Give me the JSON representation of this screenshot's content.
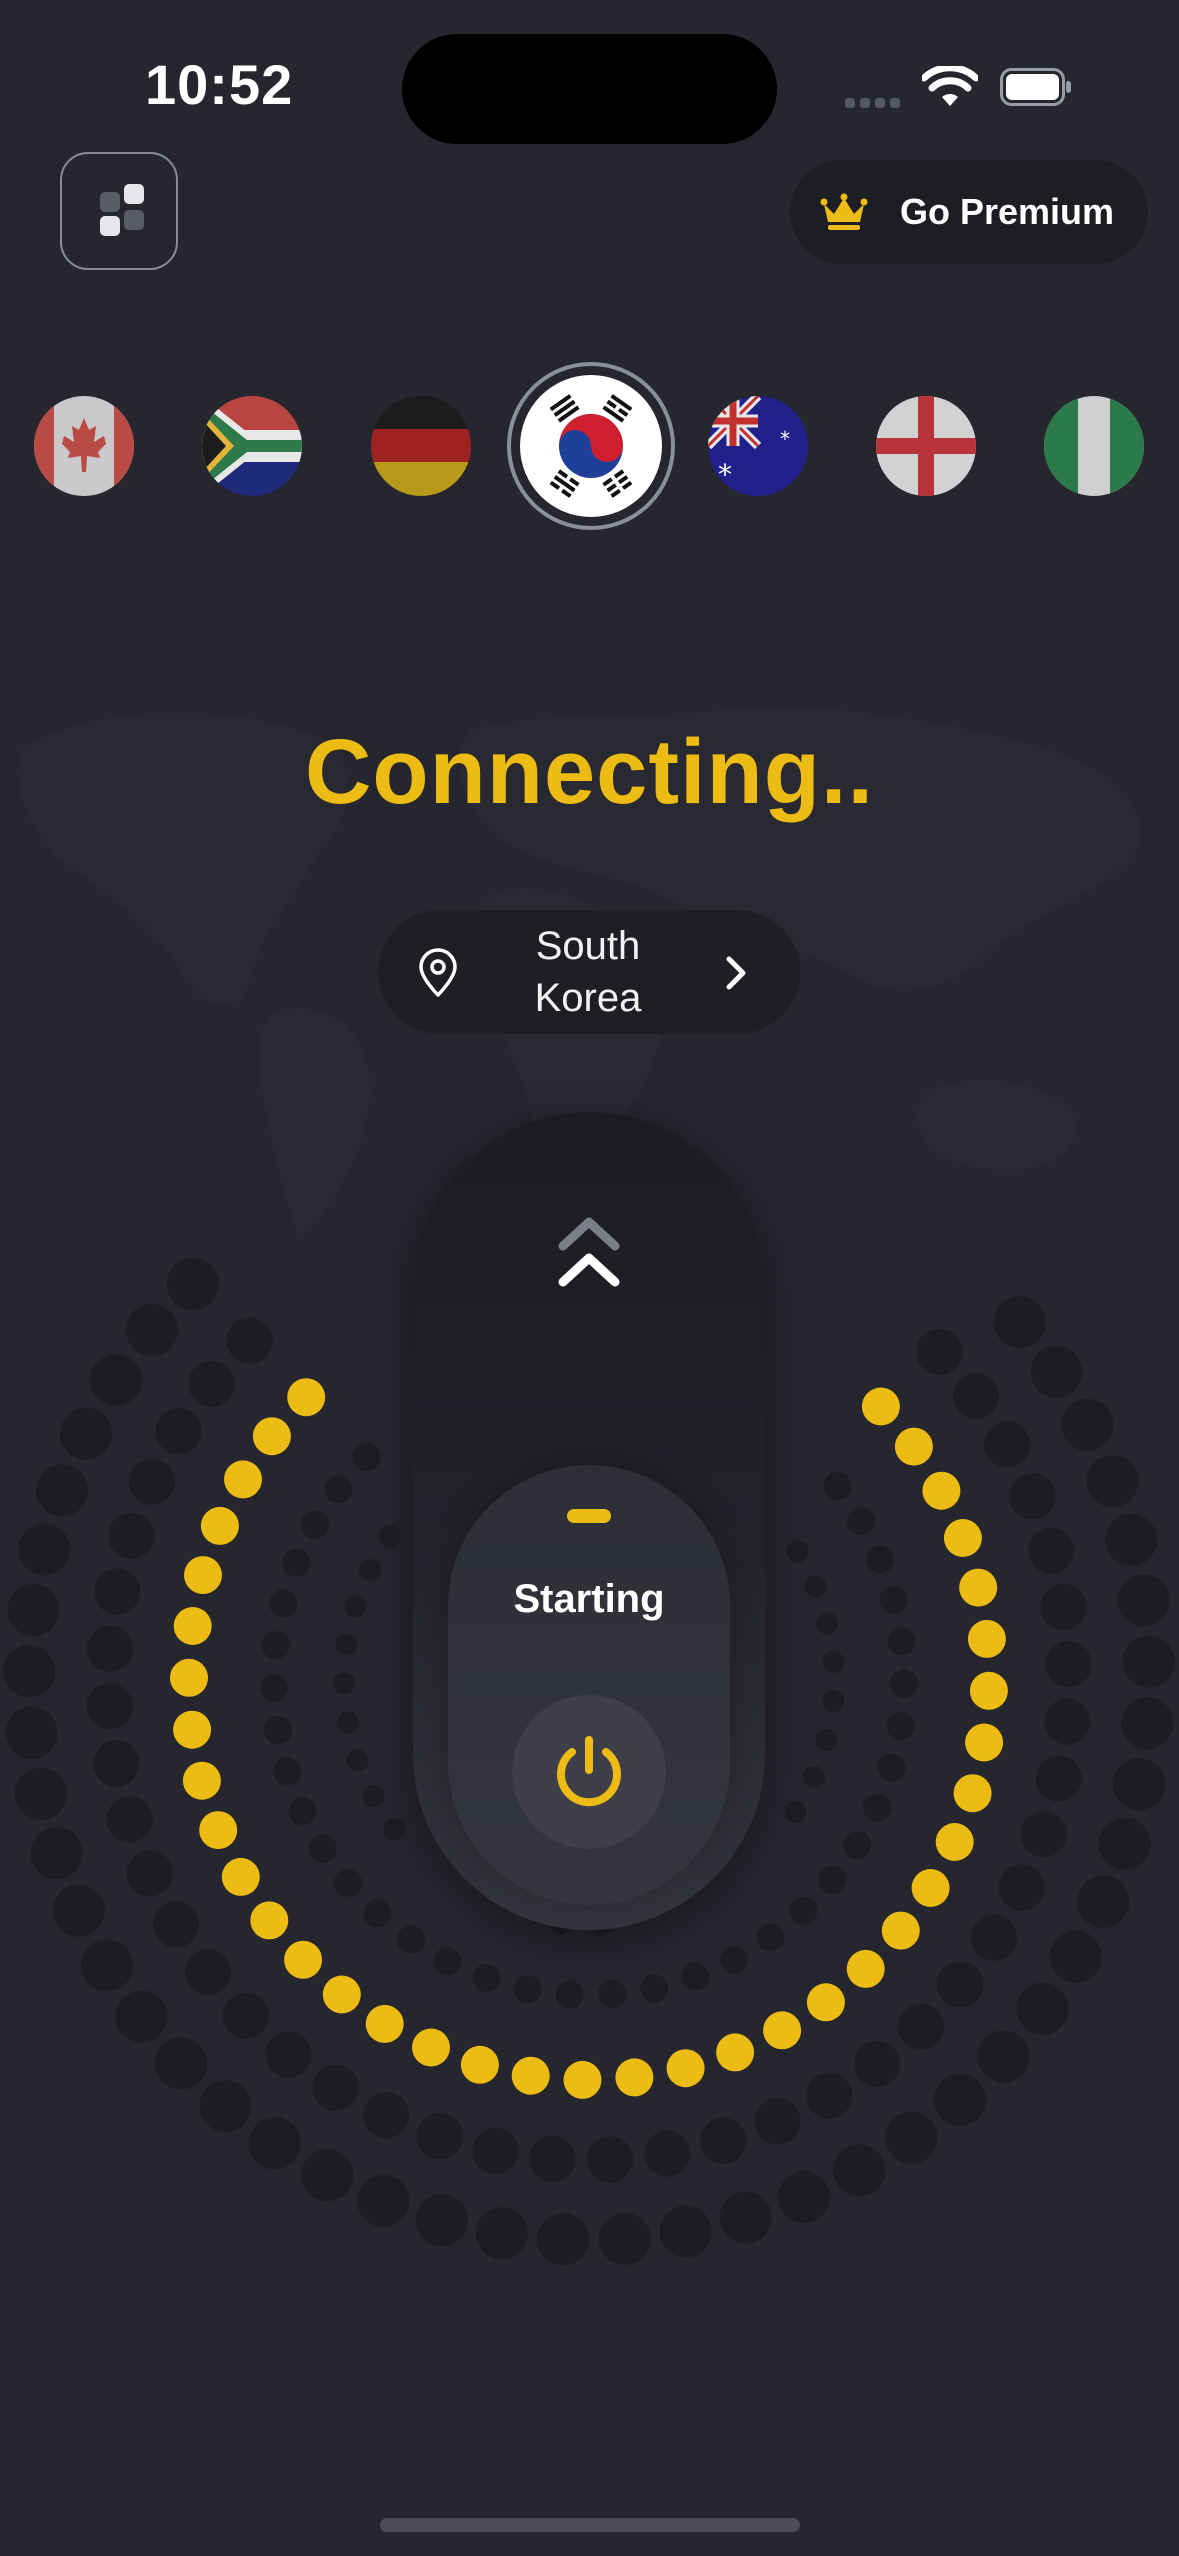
{
  "status_bar": {
    "time": "10:52"
  },
  "header": {
    "premium_label": "Go Premium",
    "menu_icon": "grid-menu-icon",
    "crown_icon": "crown-icon"
  },
  "flags": [
    {
      "country": "Canada",
      "selected": false
    },
    {
      "country": "South Africa",
      "selected": false
    },
    {
      "country": "Germany",
      "selected": false
    },
    {
      "country": "South Korea",
      "selected": true
    },
    {
      "country": "Australia",
      "selected": false
    },
    {
      "country": "England",
      "selected": false
    },
    {
      "country": "Nigeria",
      "selected": false
    }
  ],
  "connection": {
    "status": "Connecting..",
    "location": "South Korea",
    "location_line1": "South",
    "location_line2": "Korea",
    "slider_label": "Starting"
  },
  "colors": {
    "background": "#25262e",
    "accent": "#ecbc14",
    "dot_inactive": "#1c1d22",
    "pill": "#1e1f25"
  }
}
